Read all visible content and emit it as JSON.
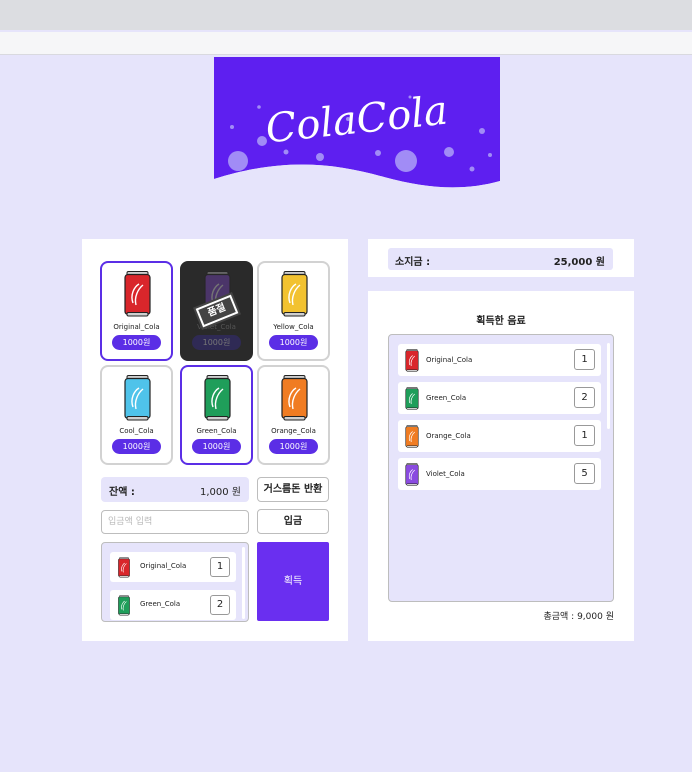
{
  "logo": {
    "text": "ColaCola",
    "bg_color": "#5e1ff0"
  },
  "machine": {
    "items": [
      {
        "name": "Original_Cola",
        "price": "1000원",
        "color": "#d9262b",
        "selected": true,
        "soldout": false
      },
      {
        "name": "Violet_Cola",
        "price": "1000원",
        "color": "#8a4be0",
        "selected": false,
        "soldout": true,
        "stamp": "품절"
      },
      {
        "name": "Yellow_Cola",
        "price": "1000원",
        "color": "#f2c230",
        "selected": false,
        "soldout": false
      },
      {
        "name": "Cool_Cola",
        "price": "1000원",
        "color": "#4fc3ea",
        "selected": false,
        "soldout": false
      },
      {
        "name": "Green_Cola",
        "price": "1000원",
        "color": "#1f9e5a",
        "selected": true,
        "soldout": false
      },
      {
        "name": "Orange_Cola",
        "price": "1000원",
        "color": "#f07c22",
        "selected": false,
        "soldout": false
      }
    ],
    "balance_label": "잔액 :",
    "balance_value": "1,000 원",
    "return_button": "거스름돈 반환",
    "deposit_placeholder": "입금액 입력",
    "deposit_button": "입금",
    "cart": [
      {
        "name": "Original_Cola",
        "qty": "1",
        "color": "#d9262b"
      },
      {
        "name": "Green_Cola",
        "qty": "2",
        "color": "#1f9e5a"
      }
    ],
    "get_button": "획득"
  },
  "wallet": {
    "label": "소지금 :",
    "value": "25,000 원"
  },
  "obtained": {
    "title": "획득한 음료",
    "items": [
      {
        "name": "Original_Cola",
        "qty": "1",
        "color": "#d9262b"
      },
      {
        "name": "Green_Cola",
        "qty": "2",
        "color": "#1f9e5a"
      },
      {
        "name": "Orange_Cola",
        "qty": "1",
        "color": "#f07c22"
      },
      {
        "name": "Violet_Cola",
        "qty": "5",
        "color": "#8a4be0"
      }
    ],
    "total": "총금액 : 9,000 원"
  },
  "colors": {
    "accent": "#5b2ee6",
    "background": "#e6e4fb"
  }
}
